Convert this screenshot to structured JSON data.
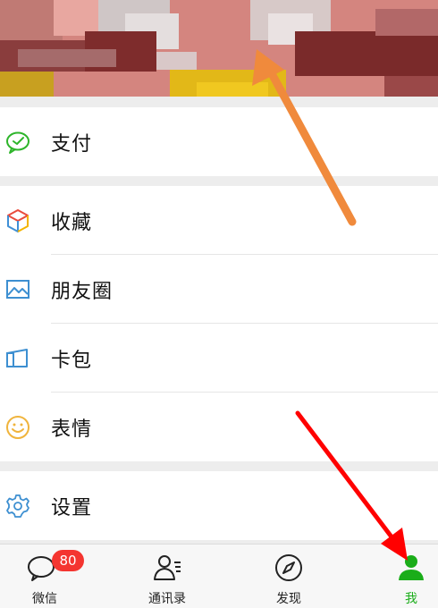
{
  "menu_groups": [
    {
      "items": [
        {
          "label": "支付",
          "icon": "wechat-pay-icon"
        }
      ]
    },
    {
      "items": [
        {
          "label": "收藏",
          "icon": "favorites-cube-icon"
        },
        {
          "label": "朋友圈",
          "icon": "moments-picture-icon"
        },
        {
          "label": "卡包",
          "icon": "card-wallet-icon"
        },
        {
          "label": "表情",
          "icon": "sticker-smiley-icon"
        }
      ]
    },
    {
      "items": [
        {
          "label": "设置",
          "icon": "settings-gear-icon"
        }
      ]
    }
  ],
  "tabbar": {
    "tabs": [
      {
        "label": "微信",
        "icon": "chat-bubble-icon",
        "badge": "80"
      },
      {
        "label": "通讯录",
        "icon": "contacts-icon"
      },
      {
        "label": "发现",
        "icon": "compass-icon"
      },
      {
        "label": "我",
        "icon": "me-person-icon",
        "active": true
      }
    ]
  },
  "colors": {
    "accent": "#1aad19",
    "badge": "#f43530",
    "orange_arrow": "#f08a3c",
    "red_arrow": "#ff0000"
  }
}
